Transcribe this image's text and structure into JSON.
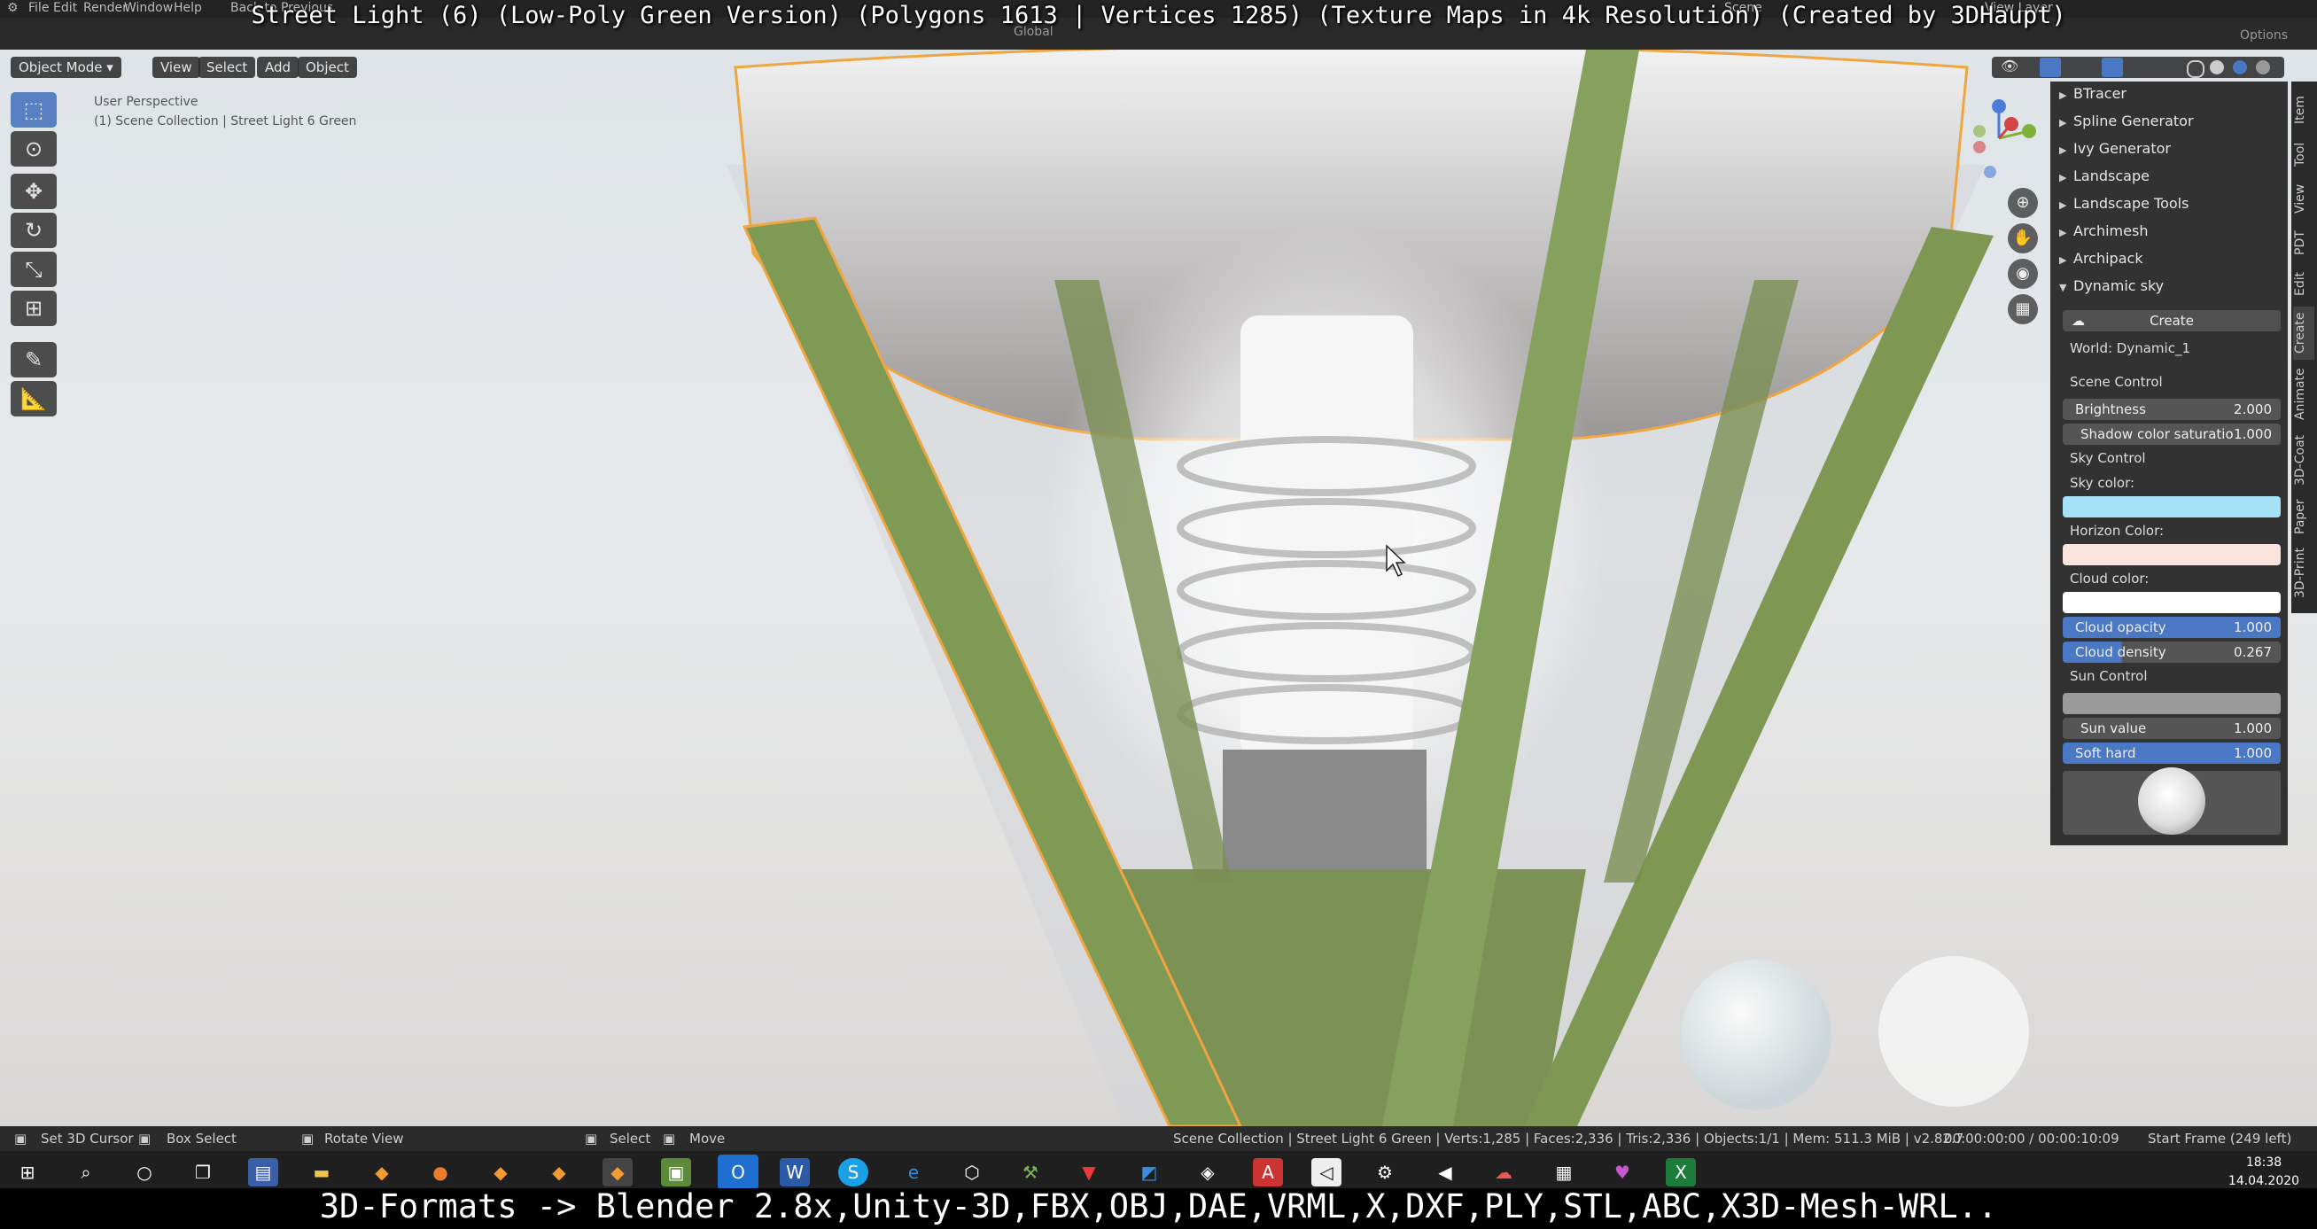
{
  "overlay": {
    "title": "Street Light (6) (Low-Poly Green Version) (Polygons 1613 | Vertices 1285) (Texture Maps in 4k Resolution) (Created by 3DHaupt)",
    "bottom": "3D-Formats -> Blender 2.8x,Unity-3D,FBX,OBJ,DAE,VRML,X,DXF,PLY,STL,ABC,X3D-Mesh-WRL.."
  },
  "menu": {
    "items": [
      "File",
      "Edit",
      "Render",
      "Window",
      "Help"
    ],
    "back": "Back to Previous",
    "scene": "Scene",
    "view_layer": "View Layer",
    "options": "Options"
  },
  "header": {
    "mode": "Object Mode",
    "view": "View",
    "select": "Select",
    "add": "Add",
    "object": "Object",
    "transform": "Global"
  },
  "viewport": {
    "perspective": "User Perspective",
    "collection": "(1) Scene Collection | Street Light 6 Green"
  },
  "npanel": {
    "addons": [
      {
        "label": "BTracer",
        "open": false
      },
      {
        "label": "Spline Generator",
        "open": false
      },
      {
        "label": "Ivy Generator",
        "open": false
      },
      {
        "label": "Landscape",
        "open": false
      },
      {
        "label": "Landscape Tools",
        "open": false
      },
      {
        "label": "Archimesh",
        "open": false
      },
      {
        "label": "Archipack",
        "open": false
      },
      {
        "label": "Dynamic sky",
        "open": true
      }
    ],
    "create_button": "Create",
    "world": "World: Dynamic_1",
    "scene_control": "Scene Control",
    "brightness_label": "Brightness",
    "brightness_value": "2.000",
    "shadow_label": "Shadow color saturatio",
    "shadow_value": "1.000",
    "sky_control": "Sky Control",
    "sky_color_label": "Sky color:",
    "horizon_color_label": "Horizon Color:",
    "cloud_color_label": "Cloud color:",
    "cloud_opacity_label": "Cloud opacity",
    "cloud_opacity_value": "1.000",
    "cloud_density_label": "Cloud density",
    "cloud_density_value": "0.267",
    "sun_control": "Sun Control",
    "sun_value_label": "Sun value",
    "sun_value_value": "1.000",
    "soft_hard_label": "Soft hard",
    "soft_hard_value": "1.000",
    "colors": {
      "sky": "#a6e2f7",
      "horizon": "#fbe3de",
      "cloud": "#ffffff"
    }
  },
  "side_tabs": [
    "Item",
    "Tool",
    "View",
    "PDT",
    "Edit",
    "Create",
    "Animate",
    "3D-Coat",
    "Paper",
    "3D-Print"
  ],
  "statusbar": {
    "set_cursor": "Set 3D Cursor",
    "box_select": "Box Select",
    "rotate_view": "Rotate View",
    "select": "Select",
    "move": "Move",
    "stats": "Scene Collection | Street Light 6 Green | Verts:1,285 | Faces:2,336 | Tris:2,336 | Objects:1/1 | Mem: 511.3 MiB | v2.82.7",
    "time": "00:00:00:00 / 00:00:10:09",
    "frame": "Start Frame (249 left)"
  },
  "clock": {
    "time": "18:38",
    "date": "14.04.2020"
  },
  "taskbar_icons": [
    "windows-icon",
    "search-icon",
    "cortana-icon",
    "task-view-icon",
    "save-icon",
    "folder-icon",
    "blender-icon",
    "firefox-icon",
    "blender-icon",
    "blender-icon",
    "blender-icon",
    "minecraft-icon",
    "outlook-icon",
    "word-icon",
    "skype-icon",
    "edge-icon",
    "cube-icon",
    "tool-icon",
    "vivaldi-icon",
    "app-icon",
    "app-icon",
    "acrobat-icon",
    "unity-icon",
    "unity-hub-icon",
    "vs-code-icon",
    "app-icon",
    "calculator-icon",
    "maps-icon",
    "excel-icon"
  ]
}
